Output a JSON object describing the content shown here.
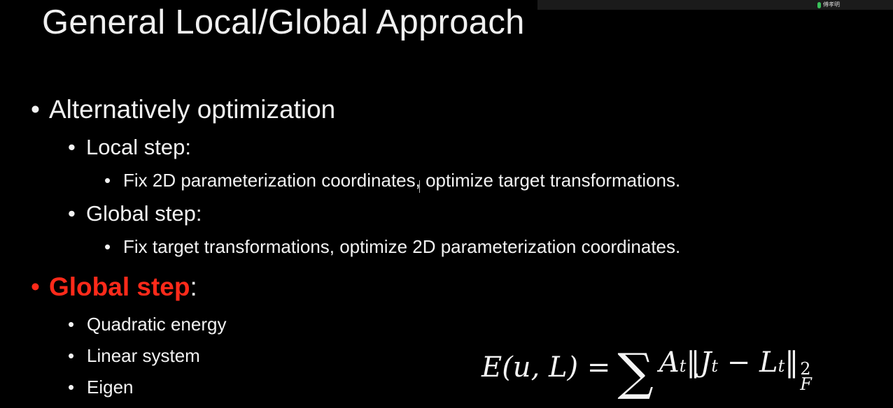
{
  "slide": {
    "title": "General Local/Global Approach",
    "bullets": {
      "b1": "Alternatively optimization",
      "b1_local": "Local step:",
      "b1_local_detail": "Fix 2D parameterization coordinates, optimize target transformations.",
      "b1_global": "Global step:",
      "b1_global_detail": "Fix target transformations, optimize 2D parameterization coordinates.",
      "b2_highlight": "Global step",
      "b2_suffix": ":",
      "b2_items": [
        "Quadratic energy",
        "Linear system",
        "Eigen"
      ]
    },
    "bullet_glyph": "•",
    "formula": {
      "lhs": "E(u, L) = ",
      "sum_symbol": "∑",
      "term_A": "A",
      "sub_t1": "t",
      "norm_open": "‖",
      "term_J": "J",
      "sub_t2": "t",
      "minus": " − ",
      "term_L": "L",
      "sub_t3": "t",
      "norm_close": "‖",
      "sup_2": "2",
      "sub_F": "F"
    },
    "colors": {
      "background": "#000000",
      "text": "#f2f2f2",
      "highlight": "#ff2a1a"
    }
  },
  "overlay": {
    "participant_name": "傅孝明",
    "mic_icon": "microphone-icon"
  }
}
